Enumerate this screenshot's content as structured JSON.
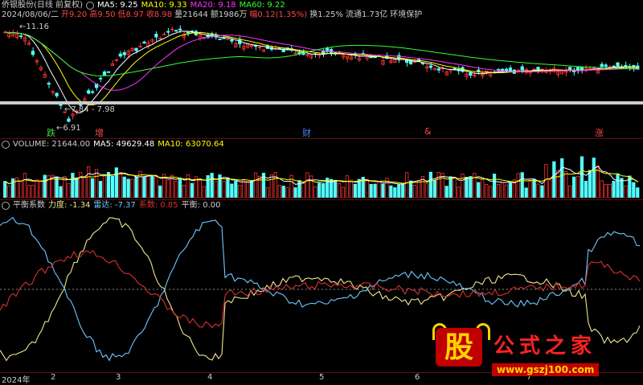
{
  "stock": {
    "title": "侨银股份(日线 前复权)",
    "ma5": "MA5: 9.25",
    "ma10": "MA10: 9.33",
    "ma20": "MA20: 9.18",
    "ma60": "MA60: 9.22"
  },
  "info_line": {
    "date": "2024/08/06/二",
    "open": "开9.20",
    "high": "高9.50",
    "low": "低8.97",
    "close": "收8.98",
    "volume": "量21644",
    "amount": "额1986万",
    "change": "幅0.12(1.35%)",
    "turnover": "换1.25%",
    "float": "流通1.73亿",
    "concept": "环境保护"
  },
  "price_markers": {
    "high_label": "11.16",
    "range_label": "7.84 - 7.98",
    "low_label": "6.91"
  },
  "signals": [
    {
      "label": "跌",
      "color": "#44dd44"
    },
    {
      "label": "增",
      "color": "#ff4444"
    },
    {
      "label": "财",
      "color": "#4488ff"
    },
    {
      "label": "&",
      "color": "#ff4444"
    },
    {
      "label": "涨",
      "color": "#ff4444"
    }
  ],
  "volume_panel": {
    "label": "VOLUME: 21644.00",
    "ma5": "MA5: 49629.48",
    "ma10": "MA10: 63070.64"
  },
  "balance_panel": {
    "title": "平衡系数",
    "force": "力度: -1.34",
    "thunder": "雷达: -7.37",
    "coef": "系数: 0.85",
    "balance": "平衡: 0.00"
  },
  "x_axis": [
    "2024年",
    "2",
    "3",
    "4",
    "5",
    "6",
    "7"
  ],
  "watermark": {
    "logo": "股",
    "name": "公式之家",
    "url": "www.gszj100.com"
  },
  "colors": {
    "up": "#ff3333",
    "down": "#54ffff",
    "ma5": "#ffffff",
    "ma10": "#ffff00",
    "ma20": "#ff33ff",
    "ma60": "#33ff33",
    "force": "#f0e68c",
    "thunder": "#6fc7ff",
    "coef": "#d93030"
  }
}
